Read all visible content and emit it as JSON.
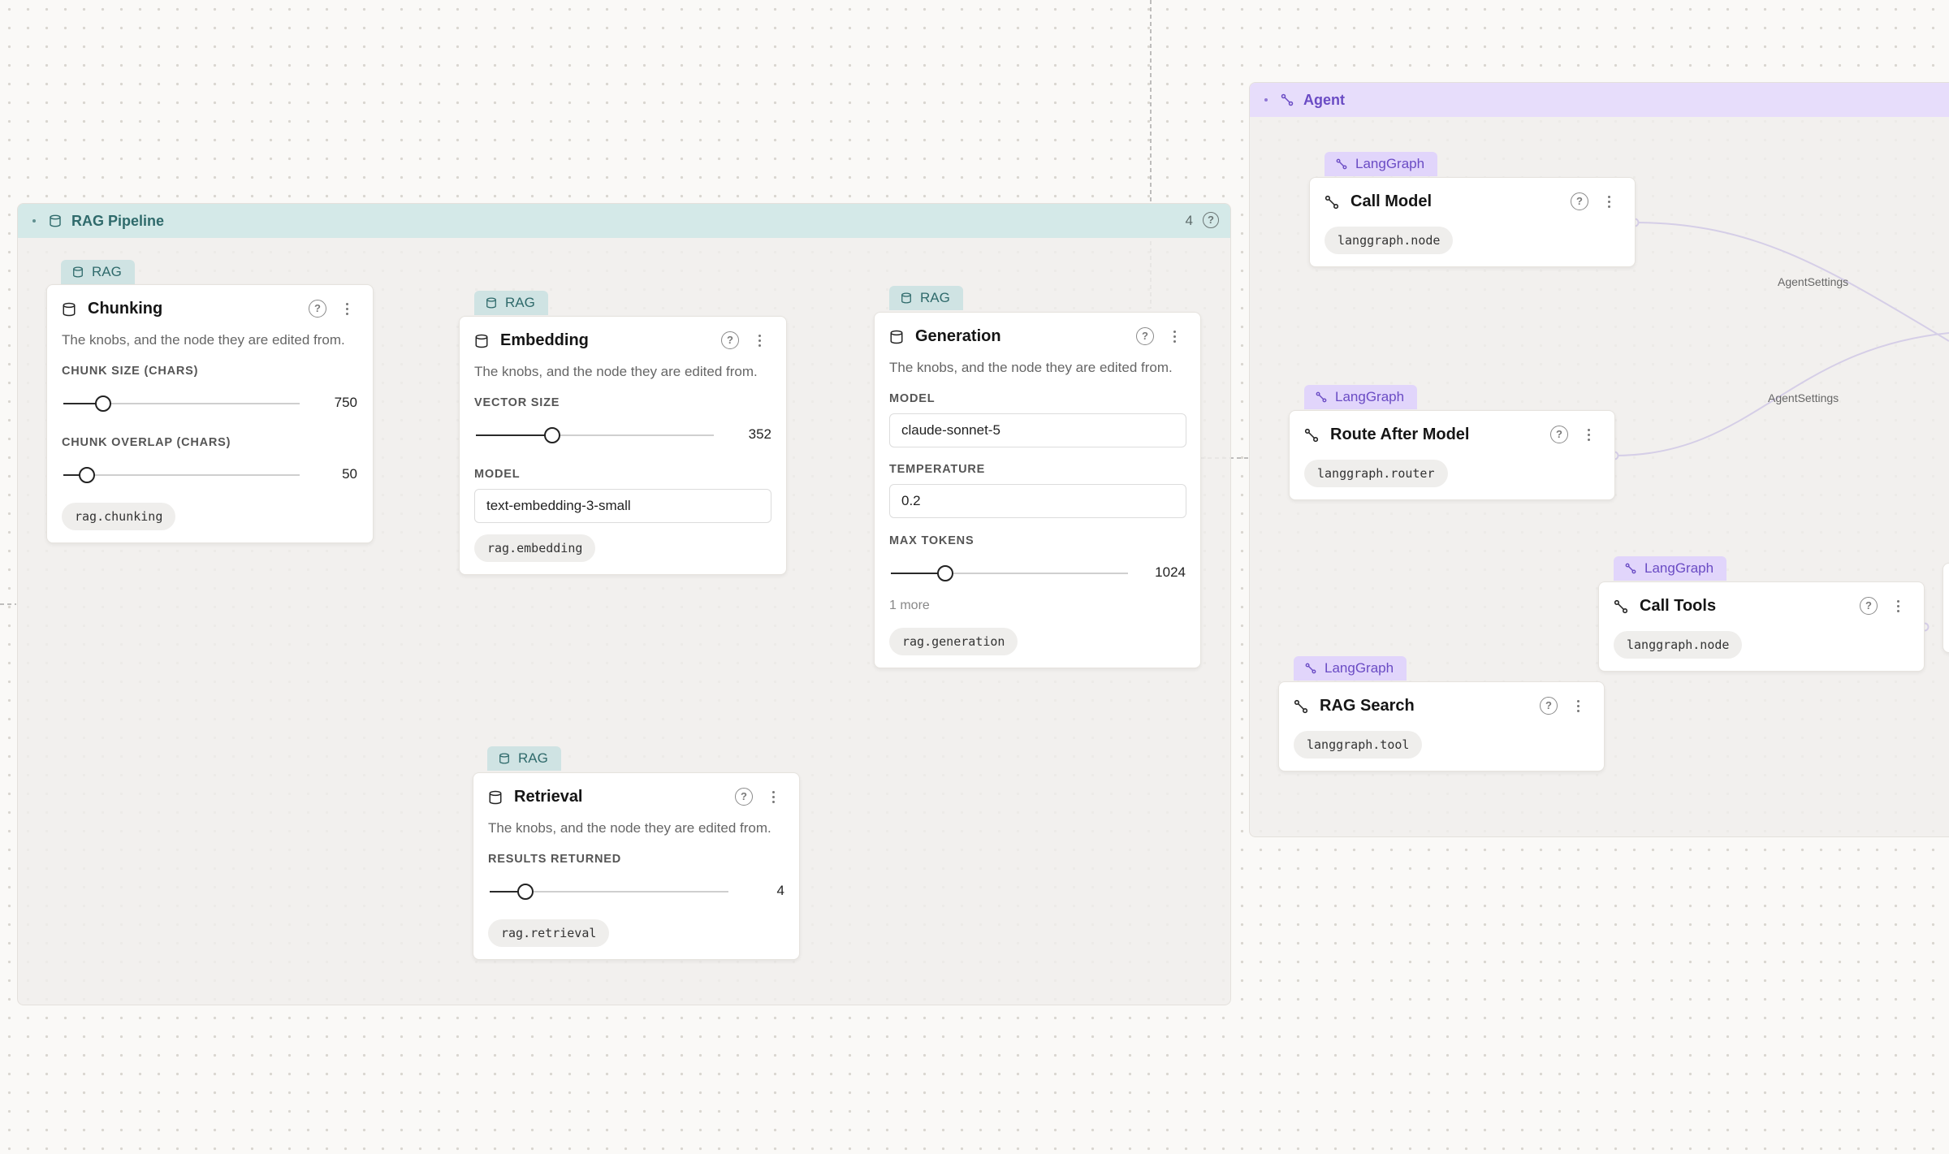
{
  "groups": {
    "rag": {
      "title": "RAG Pipeline",
      "count": "4",
      "help": "?"
    },
    "agent": {
      "title": "Agent"
    }
  },
  "common": {
    "help": "?",
    "desc": "The knobs, and the node they are edited from."
  },
  "rag_nodes": {
    "chunking": {
      "tag": "RAG",
      "title": "Chunking",
      "fields": [
        {
          "label": "CHUNK SIZE (CHARS)",
          "value": "750",
          "fraction": 0.17
        },
        {
          "label": "CHUNK OVERLAP (CHARS)",
          "value": "50",
          "fraction": 0.1
        }
      ],
      "chip": "rag.chunking"
    },
    "embedding": {
      "tag": "RAG",
      "title": "Embedding",
      "vector_label": "VECTOR SIZE",
      "vector_value": "352",
      "vector_fraction": 0.32,
      "model_label": "MODEL",
      "model_value": "text-embedding-3-small",
      "chip": "rag.embedding"
    },
    "generation": {
      "tag": "RAG",
      "title": "Generation",
      "model_label": "MODEL",
      "model_value": "claude-sonnet-5",
      "temperature_label": "TEMPERATURE",
      "temperature_value": "0.2",
      "max_tokens_label": "MAX TOKENS",
      "max_tokens_value": "1024",
      "max_tokens_fraction": 0.23,
      "more": "1 more",
      "chip": "rag.generation"
    },
    "retrieval": {
      "tag": "RAG",
      "title": "Retrieval",
      "results_label": "RESULTS RETURNED",
      "results_value": "4",
      "results_fraction": 0.15,
      "chip": "rag.retrieval"
    }
  },
  "agent_nodes": {
    "call_model": {
      "tag": "LangGraph",
      "title": "Call Model",
      "chip": "langgraph.node"
    },
    "route_after_model": {
      "tag": "LangGraph",
      "title": "Route After Model",
      "chip": "langgraph.router"
    },
    "call_tools": {
      "tag": "LangGraph",
      "title": "Call Tools",
      "chip": "langgraph.node"
    },
    "rag_search": {
      "tag": "LangGraph",
      "title": "RAG Search",
      "chip": "langgraph.tool"
    }
  },
  "edges": {
    "label_1": "AgentSettings",
    "label_2": "AgentSettings"
  },
  "colors": {
    "rag_accent": "#2f6a6b",
    "agent_accent": "#6a4bc4",
    "edge": "#5b3fd0"
  },
  "icons": {
    "rag": "database-icon",
    "langgraph": "graph-edge-icon",
    "help": "help-circle-icon",
    "menu": "more-vertical-icon"
  }
}
